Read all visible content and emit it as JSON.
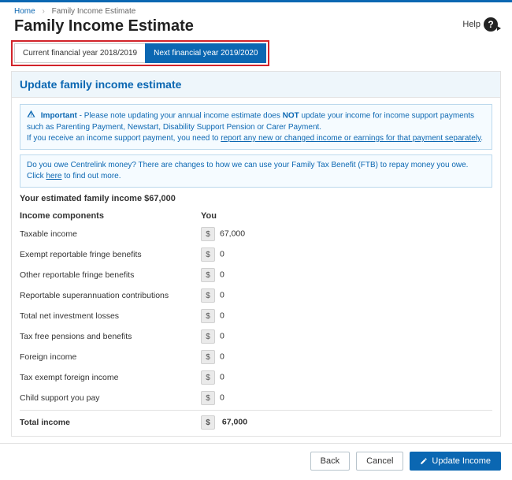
{
  "breadcrumb": {
    "home": "Home",
    "current": "Family Income Estimate"
  },
  "title": "Family Income Estimate",
  "help_label": "Help",
  "tabs": {
    "current": "Current financial year 2018/2019",
    "next": "Next financial year 2019/2020"
  },
  "panel_heading": "Update family income estimate",
  "important": {
    "label": "Important",
    "pre": " - Please note updating your annual income estimate does ",
    "not": "NOT",
    "post": " update your income for income support payments such as Parenting Payment, Newstart, Disability Support Pension or Carer Payment.",
    "line2_pre": "If you receive an income support payment, you need to ",
    "line2_link": "report any new or changed income or earnings for that payment separately",
    "line2_post": "."
  },
  "owe_notice": {
    "pre": "Do you owe Centrelink money? There are changes to how we can use your Family Tax Benefit (FTB) to repay money you owe. Click ",
    "link": "here",
    "post": " to find out more."
  },
  "estimated_line_pre": "Your estimated family income ",
  "estimated_amount": "$67,000",
  "columns": {
    "components": "Income components",
    "you": "You"
  },
  "currency_symbol": "$",
  "rows": [
    {
      "label": "Taxable income",
      "value": "67,000"
    },
    {
      "label": "Exempt reportable fringe benefits",
      "value": "0"
    },
    {
      "label": "Other reportable fringe benefits",
      "value": "0"
    },
    {
      "label": "Reportable superannuation contributions",
      "value": "0"
    },
    {
      "label": "Total net investment losses",
      "value": "0"
    },
    {
      "label": "Tax free pensions and benefits",
      "value": "0"
    },
    {
      "label": "Foreign income",
      "value": "0"
    },
    {
      "label": "Tax exempt foreign income",
      "value": "0"
    },
    {
      "label": "Child support you pay",
      "value": "0"
    }
  ],
  "total": {
    "label": "Total income",
    "value": "67,000"
  },
  "buttons": {
    "back": "Back",
    "cancel": "Cancel",
    "update": "Update Income"
  }
}
